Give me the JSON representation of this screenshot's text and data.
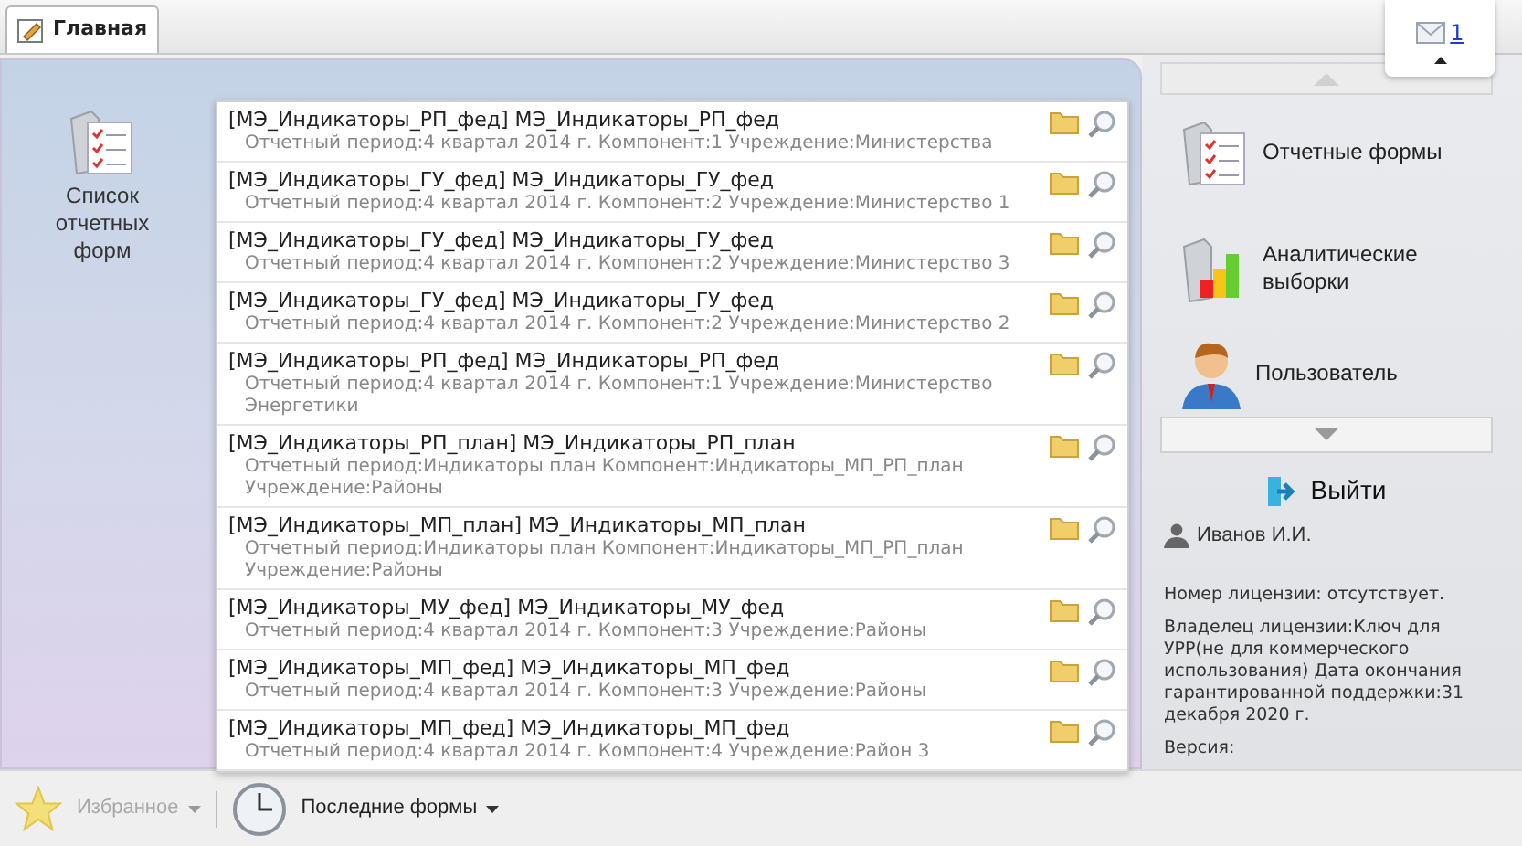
{
  "tabs": [
    {
      "label": "Главная",
      "selected": true
    }
  ],
  "mail": {
    "count": "1"
  },
  "desktop_item": {
    "label": "Список отчетных форм"
  },
  "recent_forms": [
    {
      "title": "[МЭ_Индикаторы_РП_фед] МЭ_Индикаторы_РП_фед",
      "details": "Отчетный период:4 квартал 2014 г. Компонент:1 Учреждение:Министерства"
    },
    {
      "title": "[МЭ_Индикаторы_ГУ_фед] МЭ_Индикаторы_ГУ_фед",
      "details": "Отчетный период:4 квартал 2014 г. Компонент:2 Учреждение:Министерство 1"
    },
    {
      "title": "[МЭ_Индикаторы_ГУ_фед] МЭ_Индикаторы_ГУ_фед",
      "details": "Отчетный период:4 квартал 2014 г. Компонент:2 Учреждение:Министерство 3"
    },
    {
      "title": "[МЭ_Индикаторы_ГУ_фед] МЭ_Индикаторы_ГУ_фед",
      "details": "Отчетный период:4 квартал 2014 г. Компонент:2 Учреждение:Министерство 2"
    },
    {
      "title": "[МЭ_Индикаторы_РП_фед] МЭ_Индикаторы_РП_фед",
      "details": "Отчетный период:4 квартал 2014 г. Компонент:1 Учреждение:Министерство Энергетики"
    },
    {
      "title": "[МЭ_Индикаторы_РП_план] МЭ_Индикаторы_РП_план",
      "details": "Отчетный период:Индикаторы план Компонент:Индикаторы_МП_РП_план Учреждение:Районы"
    },
    {
      "title": "[МЭ_Индикаторы_МП_план] МЭ_Индикаторы_МП_план",
      "details": "Отчетный период:Индикаторы план Компонент:Индикаторы_МП_РП_план Учреждение:Районы"
    },
    {
      "title": "[МЭ_Индикаторы_МУ_фед] МЭ_Индикаторы_МУ_фед",
      "details": "Отчетный период:4 квартал 2014 г. Компонент:3 Учреждение:Районы"
    },
    {
      "title": "[МЭ_Индикаторы_МП_фед] МЭ_Индикаторы_МП_фед",
      "details": "Отчетный период:4 квартал 2014 г. Компонент:3 Учреждение:Районы"
    },
    {
      "title": "[МЭ_Индикаторы_МП_фед] МЭ_Индикаторы_МП_фед",
      "details": "Отчетный период:4 квартал 2014 г. Компонент:4 Учреждение:Район 3"
    }
  ],
  "nav": [
    {
      "label": "Отчетные формы",
      "kind": "forms"
    },
    {
      "label": "Аналитические выборки",
      "kind": "analytics"
    },
    {
      "label": "Пользователь",
      "kind": "user"
    }
  ],
  "logout": "Выйти",
  "user": "Иванов И.И.",
  "license": [
    "Номер лицензии: отсутствует.",
    "Владелец лицензии:Ключ для УРР(не для коммерческого использования) Дата окончания гарантированной поддержки:31 декабря 2020 г.",
    "Версия:"
  ],
  "bottom_bar": [
    {
      "label": "Избранное",
      "disabled": true
    },
    {
      "label": "Последние формы",
      "disabled": false
    }
  ]
}
